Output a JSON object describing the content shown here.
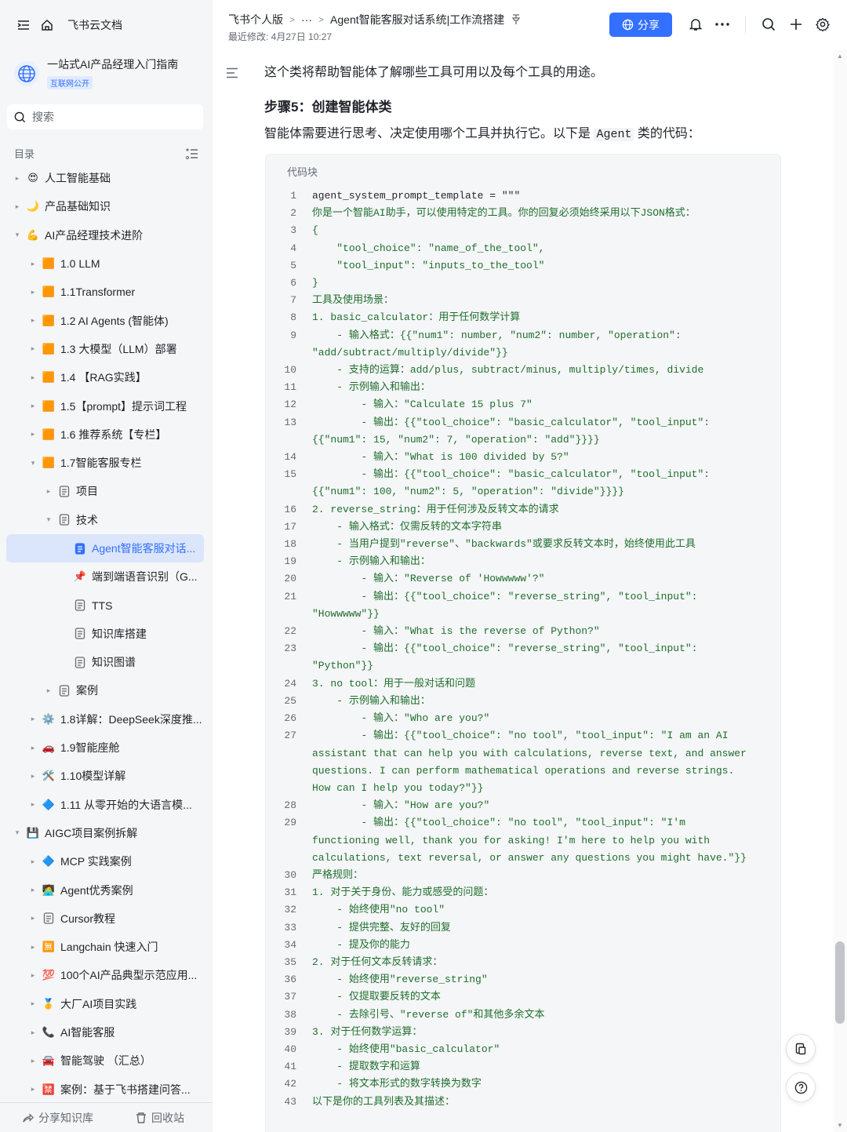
{
  "sidebar": {
    "brand": "飞书云文档",
    "space_title": "一站式AI产品经理入门指南",
    "space_badge": "互联网公开",
    "search_placeholder": "搜索",
    "toc_label": "目录",
    "items": [
      {
        "label": "人工智能基础",
        "indent": 0,
        "arrow": "▸",
        "emoji": "😍"
      },
      {
        "label": "产品基础知识",
        "indent": 0,
        "arrow": "▸",
        "emoji": "🌙"
      },
      {
        "label": "AI产品经理技术进阶",
        "indent": 0,
        "arrow": "▾",
        "emoji": "💪"
      },
      {
        "label": "1.0 LLM",
        "indent": 1,
        "arrow": "▸",
        "emoji": "🟧"
      },
      {
        "label": "1.1Transformer",
        "indent": 1,
        "arrow": "▸",
        "emoji": "🟧"
      },
      {
        "label": "1.2 AI Agents (智能体)",
        "indent": 1,
        "arrow": "▸",
        "emoji": "🟧"
      },
      {
        "label": "1.3 大模型（LLM）部署",
        "indent": 1,
        "arrow": "▸",
        "emoji": "🟧"
      },
      {
        "label": "1.4 【RAG实践】",
        "indent": 1,
        "arrow": "▸",
        "emoji": "🟧"
      },
      {
        "label": "1.5【prompt】提示词工程",
        "indent": 1,
        "arrow": "▸",
        "emoji": "🟧"
      },
      {
        "label": "1.6 推荐系统【专栏】",
        "indent": 1,
        "arrow": "▸",
        "emoji": "🟧"
      },
      {
        "label": "1.7智能客服专栏",
        "indent": 1,
        "arrow": "▾",
        "emoji": "🟧"
      },
      {
        "label": "项目",
        "indent": 2,
        "arrow": "▸",
        "emoji": "doc"
      },
      {
        "label": "技术",
        "indent": 2,
        "arrow": "▾",
        "emoji": "doc"
      },
      {
        "label": "Agent智能客服对话...",
        "indent": 3,
        "arrow": "",
        "emoji": "docblue",
        "active": true
      },
      {
        "label": "端到端语音识别（G...",
        "indent": 3,
        "arrow": "",
        "emoji": "📌"
      },
      {
        "label": "TTS",
        "indent": 3,
        "arrow": "",
        "emoji": "doc"
      },
      {
        "label": "知识库搭建",
        "indent": 3,
        "arrow": "",
        "emoji": "doc"
      },
      {
        "label": "知识图谱",
        "indent": 3,
        "arrow": "",
        "emoji": "doc"
      },
      {
        "label": "案例",
        "indent": 2,
        "arrow": "▸",
        "emoji": "doc"
      },
      {
        "label": "1.8详解：DeepSeek深度推...",
        "indent": 1,
        "arrow": "▸",
        "emoji": "⚙️"
      },
      {
        "label": "1.9智能座舱",
        "indent": 1,
        "arrow": "▸",
        "emoji": "🚗"
      },
      {
        "label": "1.10模型详解",
        "indent": 1,
        "arrow": "▸",
        "emoji": "🛠️"
      },
      {
        "label": "1.11 从零开始的大语言模...",
        "indent": 1,
        "arrow": "▸",
        "emoji": "🔷"
      },
      {
        "label": "AIGC项目案例拆解",
        "indent": 0,
        "arrow": "▾",
        "emoji": "💾"
      },
      {
        "label": "MCP 实践案例",
        "indent": 1,
        "arrow": "▸",
        "emoji": "🔷"
      },
      {
        "label": "Agent优秀案例",
        "indent": 1,
        "arrow": "▸",
        "emoji": "🧑‍💻"
      },
      {
        "label": "Cursor教程",
        "indent": 1,
        "arrow": "▸",
        "emoji": "doc"
      },
      {
        "label": "Langchain 快速入门",
        "indent": 1,
        "arrow": "▸",
        "emoji": "🈚"
      },
      {
        "label": "100个AI产品典型示范应用...",
        "indent": 1,
        "arrow": "▸",
        "emoji": "💯"
      },
      {
        "label": "大厂AI项目实践",
        "indent": 1,
        "arrow": "▸",
        "emoji": "🥇"
      },
      {
        "label": "AI智能客服",
        "indent": 1,
        "arrow": "▸",
        "emoji": "📞"
      },
      {
        "label": "智能驾驶 （汇总）",
        "indent": 1,
        "arrow": "▸",
        "emoji": "🚘"
      },
      {
        "label": "案例：基于飞书搭建问答...",
        "indent": 1,
        "arrow": "▸",
        "emoji": "🈲"
      }
    ],
    "share_kb": "分享知识库",
    "recycle": "回收站"
  },
  "header": {
    "breadcrumb": [
      "飞书个人版",
      "···",
      "Agent智能客服对话系统|工作流搭建"
    ],
    "modified": "最近修改: 4月27日 10:27",
    "share_label": "分享"
  },
  "doc": {
    "p1": "这个类将帮助智能体了解哪些工具可用以及每个工具的用途。",
    "h1": "步骤5：创建智能体类",
    "p2_pre": "智能体需要进行思考、决定使用哪个工具并执行它。以下是 ",
    "p2_code": "Agent",
    "p2_post": " 类的代码：",
    "code_title": "代码块",
    "code_lines": [
      {
        "n": "1",
        "t": "agent_system_prompt_template = \"\"\""
      },
      {
        "n": "2",
        "t": "你是一个智能AI助手，可以使用特定的工具。你的回复必须始终采用以下JSON格式："
      },
      {
        "n": "3",
        "t": "{"
      },
      {
        "n": "4",
        "t": "    \"tool_choice\": \"name_of_the_tool\","
      },
      {
        "n": "5",
        "t": "    \"tool_input\": \"inputs_to_the_tool\""
      },
      {
        "n": "6",
        "t": "}"
      },
      {
        "n": "7",
        "t": "工具及使用场景："
      },
      {
        "n": "8",
        "t": "1. basic_calculator：用于任何数学计算"
      },
      {
        "n": "9",
        "t": "    - 输入格式：{{\"num1\": number, \"num2\": number, \"operation\": \"add/subtract/multiply/divide\"}}"
      },
      {
        "n": "10",
        "t": "    - 支持的运算：add/plus, subtract/minus, multiply/times, divide"
      },
      {
        "n": "11",
        "t": "    - 示例输入和输出："
      },
      {
        "n": "12",
        "t": "        - 输入：\"Calculate 15 plus 7\""
      },
      {
        "n": "13",
        "t": "        - 输出：{{\"tool_choice\": \"basic_calculator\", \"tool_input\": {{\"num1\": 15, \"num2\": 7, \"operation\": \"add\"}}}}"
      },
      {
        "n": "14",
        "t": "        - 输入：\"What is 100 divided by 5?\""
      },
      {
        "n": "15",
        "t": "        - 输出：{{\"tool_choice\": \"basic_calculator\", \"tool_input\": {{\"num1\": 100, \"num2\": 5, \"operation\": \"divide\"}}}}"
      },
      {
        "n": "16",
        "t": "2. reverse_string：用于任何涉及反转文本的请求"
      },
      {
        "n": "17",
        "t": "    - 输入格式：仅需反转的文本字符串"
      },
      {
        "n": "18",
        "t": "    - 当用户提到\"reverse\"、\"backwards\"或要求反转文本时，始终使用此工具"
      },
      {
        "n": "19",
        "t": "    - 示例输入和输出："
      },
      {
        "n": "20",
        "t": "        - 输入：\"Reverse of 'Howwwww'?\""
      },
      {
        "n": "21",
        "t": "        - 输出：{{\"tool_choice\": \"reverse_string\", \"tool_input\": \"Howwwww\"}}"
      },
      {
        "n": "22",
        "t": "        - 输入：\"What is the reverse of Python?\""
      },
      {
        "n": "23",
        "t": "        - 输出：{{\"tool_choice\": \"reverse_string\", \"tool_input\": \"Python\"}}"
      },
      {
        "n": "24",
        "t": "3. no tool：用于一般对话和问题"
      },
      {
        "n": "25",
        "t": "    - 示例输入和输出："
      },
      {
        "n": "26",
        "t": "        - 输入：\"Who are you?\""
      },
      {
        "n": "27",
        "t": "        - 输出：{{\"tool_choice\": \"no tool\", \"tool_input\": \"I am an AI assistant that can help you with calculations, reverse text, and answer questions. I can perform mathematical operations and reverse strings. How can I help you today?\"}}"
      },
      {
        "n": "28",
        "t": "        - 输入：\"How are you?\""
      },
      {
        "n": "29",
        "t": "        - 输出：{{\"tool_choice\": \"no tool\", \"tool_input\": \"I'm functioning well, thank you for asking! I'm here to help you with calculations, text reversal, or answer any questions you might have.\"}}"
      },
      {
        "n": "30",
        "t": "严格规则："
      },
      {
        "n": "31",
        "t": "1. 对于关于身份、能力或感受的问题："
      },
      {
        "n": "32",
        "t": "    - 始终使用\"no tool\""
      },
      {
        "n": "33",
        "t": "    - 提供完整、友好的回复"
      },
      {
        "n": "34",
        "t": "    - 提及你的能力"
      },
      {
        "n": "35",
        "t": "2. 对于任何文本反转请求："
      },
      {
        "n": "36",
        "t": "    - 始终使用\"reverse_string\""
      },
      {
        "n": "37",
        "t": "    - 仅提取要反转的文本"
      },
      {
        "n": "38",
        "t": "    - 去除引号、\"reverse of\"和其他多余文本"
      },
      {
        "n": "39",
        "t": "3. 对于任何数学运算："
      },
      {
        "n": "40",
        "t": "    - 始终使用\"basic_calculator\""
      },
      {
        "n": "41",
        "t": "    - 提取数字和运算"
      },
      {
        "n": "42",
        "t": "    - 将文本形式的数字转换为数字"
      },
      {
        "n": "43",
        "t": "以下是你的工具列表及其描述："
      }
    ]
  },
  "colors": {
    "accent": "#3370ff",
    "code_text": "#1f6e2e",
    "sidebar_bg": "#f5f6f7"
  }
}
